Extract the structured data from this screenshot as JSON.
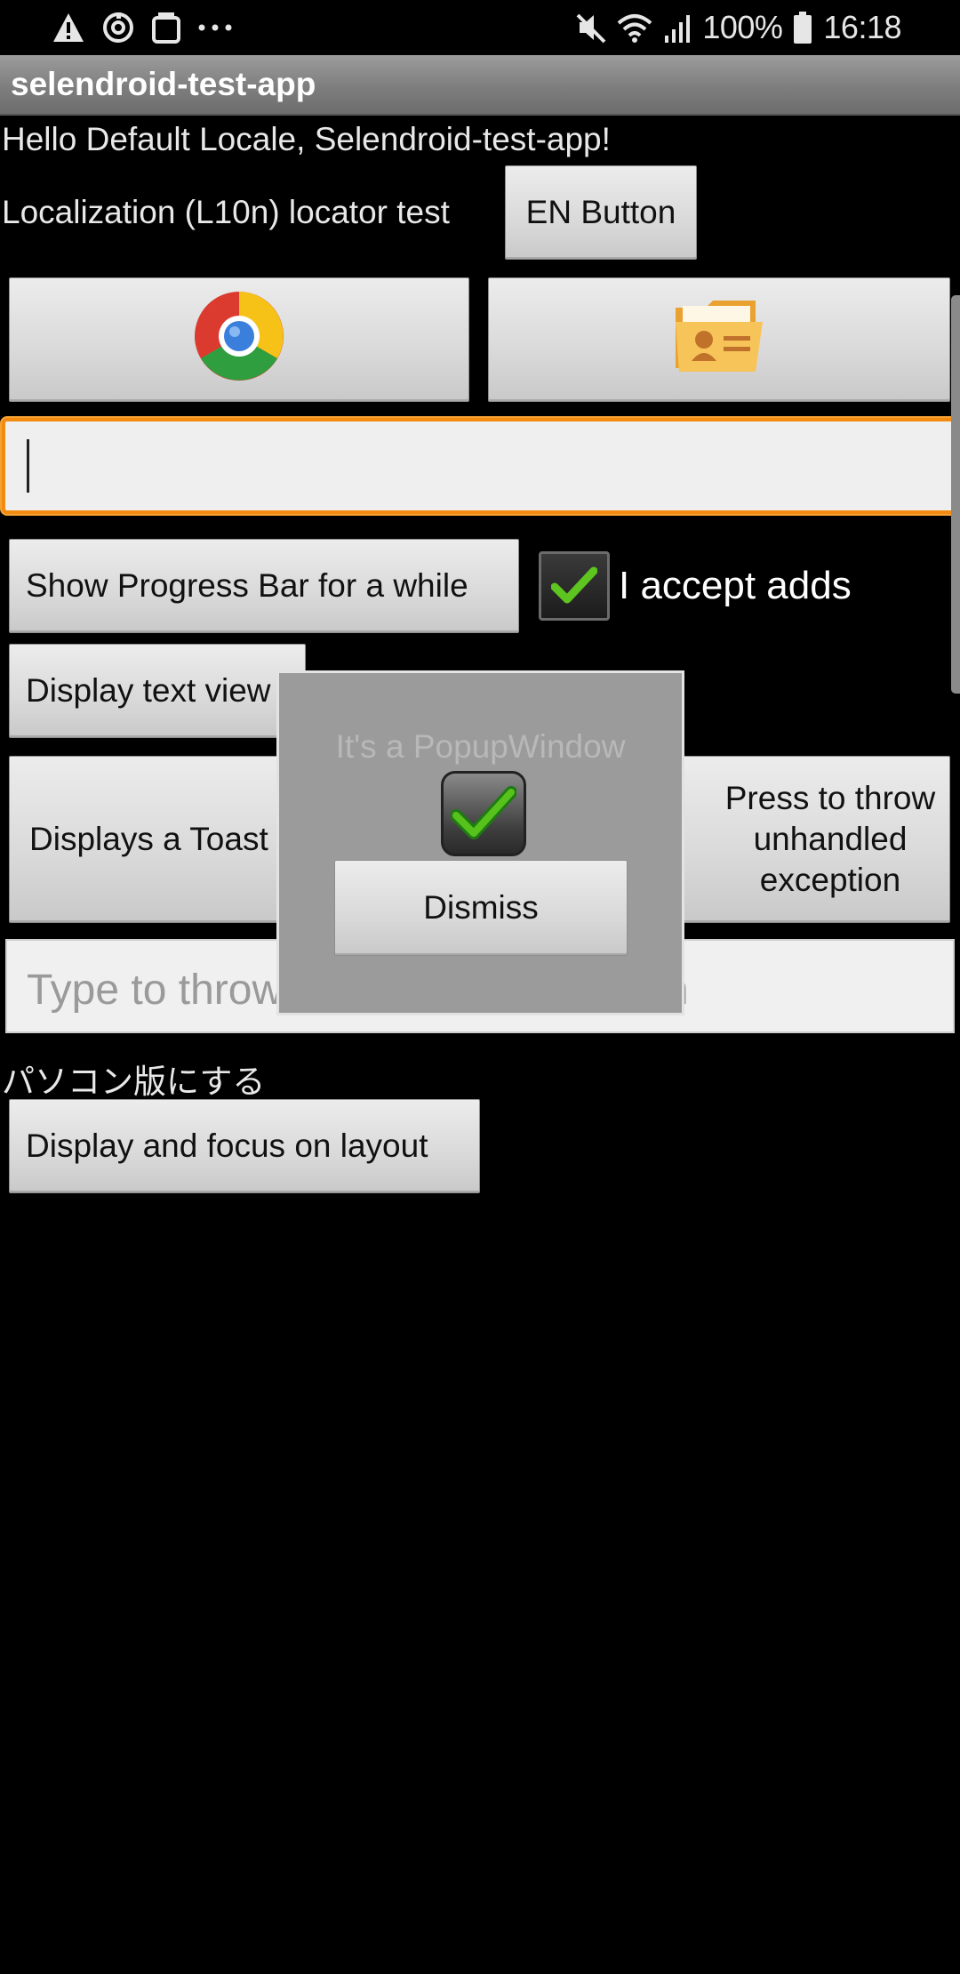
{
  "status_bar": {
    "left_icons": [
      "warning-icon",
      "sync-icon",
      "clipboard-icon",
      "more-dots-icon"
    ],
    "battery_percent": "100%",
    "time": "16:18",
    "right_icons": [
      "mute-icon",
      "wifi-icon",
      "signal-icon",
      "battery-icon"
    ]
  },
  "app_bar": {
    "title": "selendroid-test-app"
  },
  "main": {
    "hello_text": "Hello Default Locale, Selendroid-test-app!",
    "l10n_label": "Localization (L10n) locator test",
    "en_button": "EN Button",
    "chrome_button_icon": "chrome-icon",
    "contacts_button_icon": "contacts-folder-icon",
    "text_input": {
      "value": ""
    },
    "progress_button": "Show Progress Bar for a while",
    "accept_adds": {
      "label": "I accept adds",
      "checked": true
    },
    "display_text_view_button": "Display text view",
    "toast_button": "Displays a Toast",
    "exception_button_lines": [
      "Press to throw",
      "unhandled",
      "exception"
    ],
    "exception_input_placeholder": "Type to throw unhandled exception",
    "japanese_label": "パソコン版にする",
    "focus_layout_button": "Display and focus on layout"
  },
  "popup": {
    "title": "It's a PopupWindow",
    "checkbox_checked": true,
    "dismiss_button": "Dismiss"
  },
  "colors": {
    "focus_border": "#f38b10",
    "check_green": "#5ec41f",
    "app_bar": "#8a8a8a",
    "popup_bg": "#9b9b9b"
  }
}
